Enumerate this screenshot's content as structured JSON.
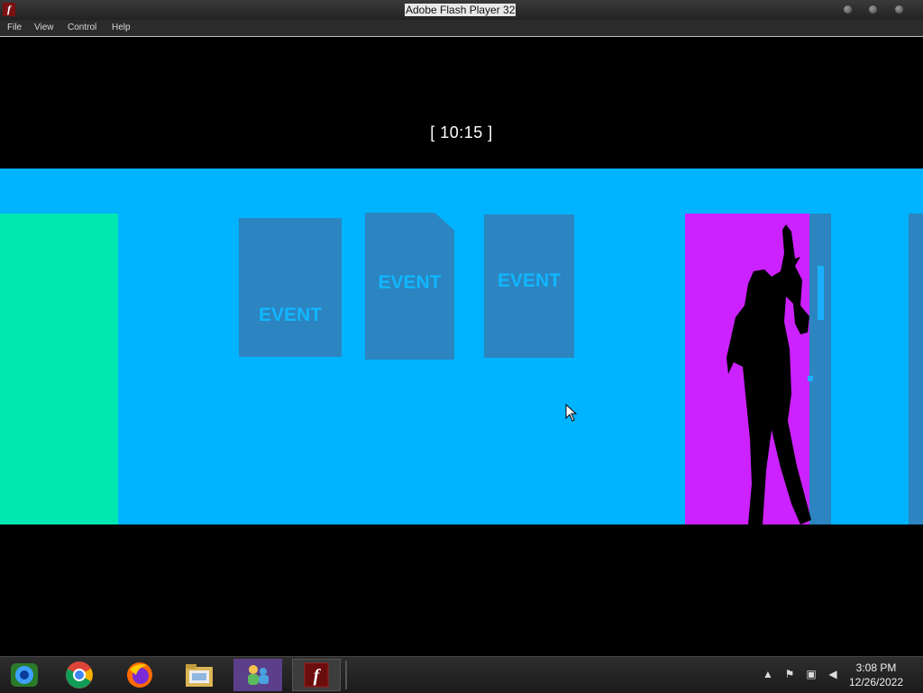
{
  "window": {
    "title": "Adobe Flash Player 32",
    "icon": "flash-icon"
  },
  "menu": {
    "items": [
      "File",
      "View",
      "Control",
      "Help"
    ]
  },
  "game": {
    "timer": "[ 10:15 ]",
    "posters": [
      "EVENT",
      "EVENT",
      "EVENT"
    ],
    "colors": {
      "wall": "#00b3ff",
      "green_door": "#00e8b0",
      "magenta_door": "#cc22ff",
      "poster": "#2c84c0"
    }
  },
  "taskbar": {
    "apps": [
      "media-player-icon",
      "chrome-icon",
      "firefox-icon",
      "file-explorer-icon",
      "messenger-icon",
      "flash-player-icon"
    ],
    "tray": [
      "show-hidden-icons-icon",
      "action-center-flag-icon",
      "network-icon",
      "volume-icon"
    ],
    "clock": {
      "time": "3:08 PM",
      "date": "12/26/2022"
    }
  }
}
